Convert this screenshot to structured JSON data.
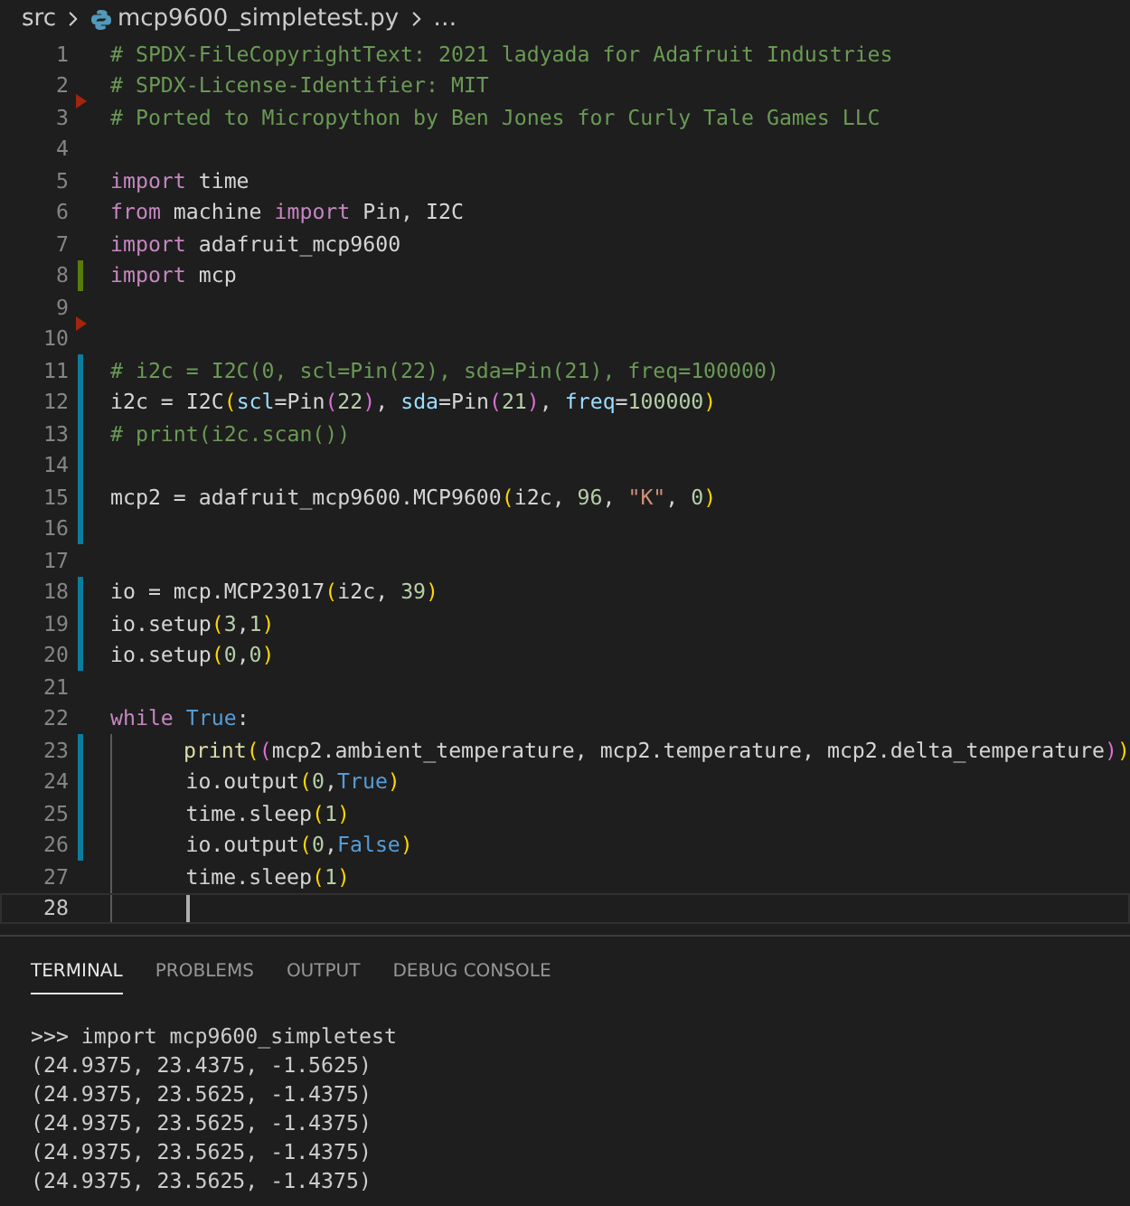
{
  "breadcrumb": {
    "folder": "src",
    "file": "mcp9600_simpletest.py",
    "more": "…"
  },
  "editor": {
    "lines": [
      {
        "number": "1",
        "tokens": [
          {
            "text": "# SPDX-FileCopyrightText: 2021 ladyada for Adafruit Industries",
            "kind": "comment"
          }
        ]
      },
      {
        "number": "2",
        "deleted_after": true,
        "tokens": [
          {
            "text": "# SPDX-License-Identifier: MIT",
            "kind": "comment"
          }
        ]
      },
      {
        "number": "3",
        "tokens": [
          {
            "text": "# Ported to Micropython by Ben Jones for Curly Tale Games LLC",
            "kind": "comment"
          }
        ]
      },
      {
        "number": "4"
      },
      {
        "number": "5",
        "tokens": [
          {
            "text": "import",
            "kind": "keyword"
          },
          {
            "text": " time",
            "kind": "plain"
          }
        ]
      },
      {
        "number": "6",
        "tokens": [
          {
            "text": "from",
            "kind": "keyword"
          },
          {
            "text": " machine ",
            "kind": "plain"
          },
          {
            "text": "import",
            "kind": "keyword"
          },
          {
            "text": " Pin, I2C",
            "kind": "plain"
          }
        ]
      },
      {
        "number": "7",
        "tokens": [
          {
            "text": "import",
            "kind": "keyword"
          },
          {
            "text": " adafruit_mcp9600",
            "kind": "plain"
          }
        ]
      },
      {
        "number": "8",
        "added": true,
        "tokens": [
          {
            "text": "import",
            "kind": "keyword"
          },
          {
            "text": " mcp",
            "kind": "plain"
          }
        ]
      },
      {
        "number": "9",
        "deleted_after": true
      },
      {
        "number": "10"
      },
      {
        "number": "11",
        "modified": true,
        "tokens": [
          {
            "text": "# i2c = I2C(0, scl=Pin(22), sda=Pin(21), freq=100000)",
            "kind": "comment"
          }
        ]
      },
      {
        "number": "12",
        "modified": true,
        "tokens": [
          {
            "text": "i2c = I2C",
            "kind": "plain"
          },
          {
            "text": "(",
            "kind": "bracket1"
          },
          {
            "text": "scl",
            "kind": "param"
          },
          {
            "text": "=Pin",
            "kind": "plain"
          },
          {
            "text": "(",
            "kind": "bracket2"
          },
          {
            "text": "22",
            "kind": "number"
          },
          {
            "text": ")",
            "kind": "bracket2"
          },
          {
            "text": ", ",
            "kind": "plain"
          },
          {
            "text": "sda",
            "kind": "param"
          },
          {
            "text": "=Pin",
            "kind": "plain"
          },
          {
            "text": "(",
            "kind": "bracket2"
          },
          {
            "text": "21",
            "kind": "number"
          },
          {
            "text": ")",
            "kind": "bracket2"
          },
          {
            "text": ", ",
            "kind": "plain"
          },
          {
            "text": "freq",
            "kind": "param"
          },
          {
            "text": "=",
            "kind": "plain"
          },
          {
            "text": "100000",
            "kind": "number"
          },
          {
            "text": ")",
            "kind": "bracket1"
          }
        ]
      },
      {
        "number": "13",
        "modified": true,
        "tokens": [
          {
            "text": "# print(i2c.scan())",
            "kind": "comment"
          }
        ]
      },
      {
        "number": "14",
        "modified": true
      },
      {
        "number": "15",
        "modified": true,
        "tokens": [
          {
            "text": "mcp2 = adafruit_mcp9600.MCP9600",
            "kind": "plain"
          },
          {
            "text": "(",
            "kind": "bracket1"
          },
          {
            "text": "i2c, ",
            "kind": "plain"
          },
          {
            "text": "96",
            "kind": "number"
          },
          {
            "text": ", ",
            "kind": "plain"
          },
          {
            "text": "\"K\"",
            "kind": "string"
          },
          {
            "text": ", ",
            "kind": "plain"
          },
          {
            "text": "0",
            "kind": "number"
          },
          {
            "text": ")",
            "kind": "bracket1"
          }
        ]
      },
      {
        "number": "16",
        "modified": true
      },
      {
        "number": "17"
      },
      {
        "number": "18",
        "modified": true,
        "tokens": [
          {
            "text": "io = mcp.MCP23017",
            "kind": "plain"
          },
          {
            "text": "(",
            "kind": "bracket1"
          },
          {
            "text": "i2c, ",
            "kind": "plain"
          },
          {
            "text": "39",
            "kind": "number"
          },
          {
            "text": ")",
            "kind": "bracket1"
          }
        ]
      },
      {
        "number": "19",
        "modified": true,
        "tokens": [
          {
            "text": "io.setup",
            "kind": "plain"
          },
          {
            "text": "(",
            "kind": "bracket1"
          },
          {
            "text": "3",
            "kind": "number"
          },
          {
            "text": ",",
            "kind": "plain"
          },
          {
            "text": "1",
            "kind": "number"
          },
          {
            "text": ")",
            "kind": "bracket1"
          }
        ]
      },
      {
        "number": "20",
        "modified": true,
        "tokens": [
          {
            "text": "io.setup",
            "kind": "plain"
          },
          {
            "text": "(",
            "kind": "bracket1"
          },
          {
            "text": "0",
            "kind": "number"
          },
          {
            "text": ",",
            "kind": "plain"
          },
          {
            "text": "0",
            "kind": "number"
          },
          {
            "text": ")",
            "kind": "bracket1"
          }
        ]
      },
      {
        "number": "21"
      },
      {
        "number": "22",
        "tokens": [
          {
            "text": "while",
            "kind": "keyword"
          },
          {
            "text": " True",
            "kind": "constant"
          },
          {
            "text": ":",
            "kind": "plain"
          }
        ]
      },
      {
        "number": "23",
        "modified": true,
        "indented": true,
        "tokens": [
          {
            "text": "print",
            "kind": "function"
          },
          {
            "text": "(",
            "kind": "bracket1"
          },
          {
            "text": "(",
            "kind": "bracket2"
          },
          {
            "text": "mcp2.ambient_temperature, mcp2.temperature, mcp2.delta_temperature",
            "kind": "plain"
          },
          {
            "text": ")",
            "kind": "bracket2"
          },
          {
            "text": ")",
            "kind": "bracket1"
          }
        ]
      },
      {
        "number": "24",
        "modified": true,
        "indented": true,
        "tokens": [
          {
            "text": "io.output",
            "kind": "plain"
          },
          {
            "text": "(",
            "kind": "bracket1"
          },
          {
            "text": "0",
            "kind": "number"
          },
          {
            "text": ",",
            "kind": "plain"
          },
          {
            "text": "True",
            "kind": "constant"
          },
          {
            "text": ")",
            "kind": "bracket1"
          }
        ]
      },
      {
        "number": "25",
        "modified": true,
        "indented": true,
        "tokens": [
          {
            "text": "time.sleep",
            "kind": "plain"
          },
          {
            "text": "(",
            "kind": "bracket1"
          },
          {
            "text": "1",
            "kind": "number"
          },
          {
            "text": ")",
            "kind": "bracket1"
          }
        ]
      },
      {
        "number": "26",
        "modified": true,
        "indented": true,
        "tokens": [
          {
            "text": "io.output",
            "kind": "plain"
          },
          {
            "text": "(",
            "kind": "bracket1"
          },
          {
            "text": "0",
            "kind": "number"
          },
          {
            "text": ",",
            "kind": "plain"
          },
          {
            "text": "False",
            "kind": "constant"
          },
          {
            "text": ")",
            "kind": "bracket1"
          }
        ]
      },
      {
        "number": "27",
        "indented": true,
        "tokens": [
          {
            "text": "time.sleep",
            "kind": "plain"
          },
          {
            "text": "(",
            "kind": "bracket1"
          },
          {
            "text": "1",
            "kind": "number"
          },
          {
            "text": ")",
            "kind": "bracket1"
          }
        ]
      },
      {
        "number": "28",
        "current": true,
        "indented": true
      }
    ]
  },
  "panel": {
    "tabs": [
      {
        "label": "TERMINAL",
        "selected": true
      },
      {
        "label": "PROBLEMS",
        "selected": false
      },
      {
        "label": "OUTPUT",
        "selected": false
      },
      {
        "label": "DEBUG CONSOLE",
        "selected": false
      }
    ],
    "terminal_lines": [
      ">>> import mcp9600_simpletest",
      "(24.9375, 23.4375, -1.5625)",
      "(24.9375, 23.5625, -1.4375)",
      "(24.9375, 23.5625, -1.4375)",
      "(24.9375, 23.5625, -1.4375)",
      "(24.9375, 23.5625, -1.4375)"
    ]
  }
}
